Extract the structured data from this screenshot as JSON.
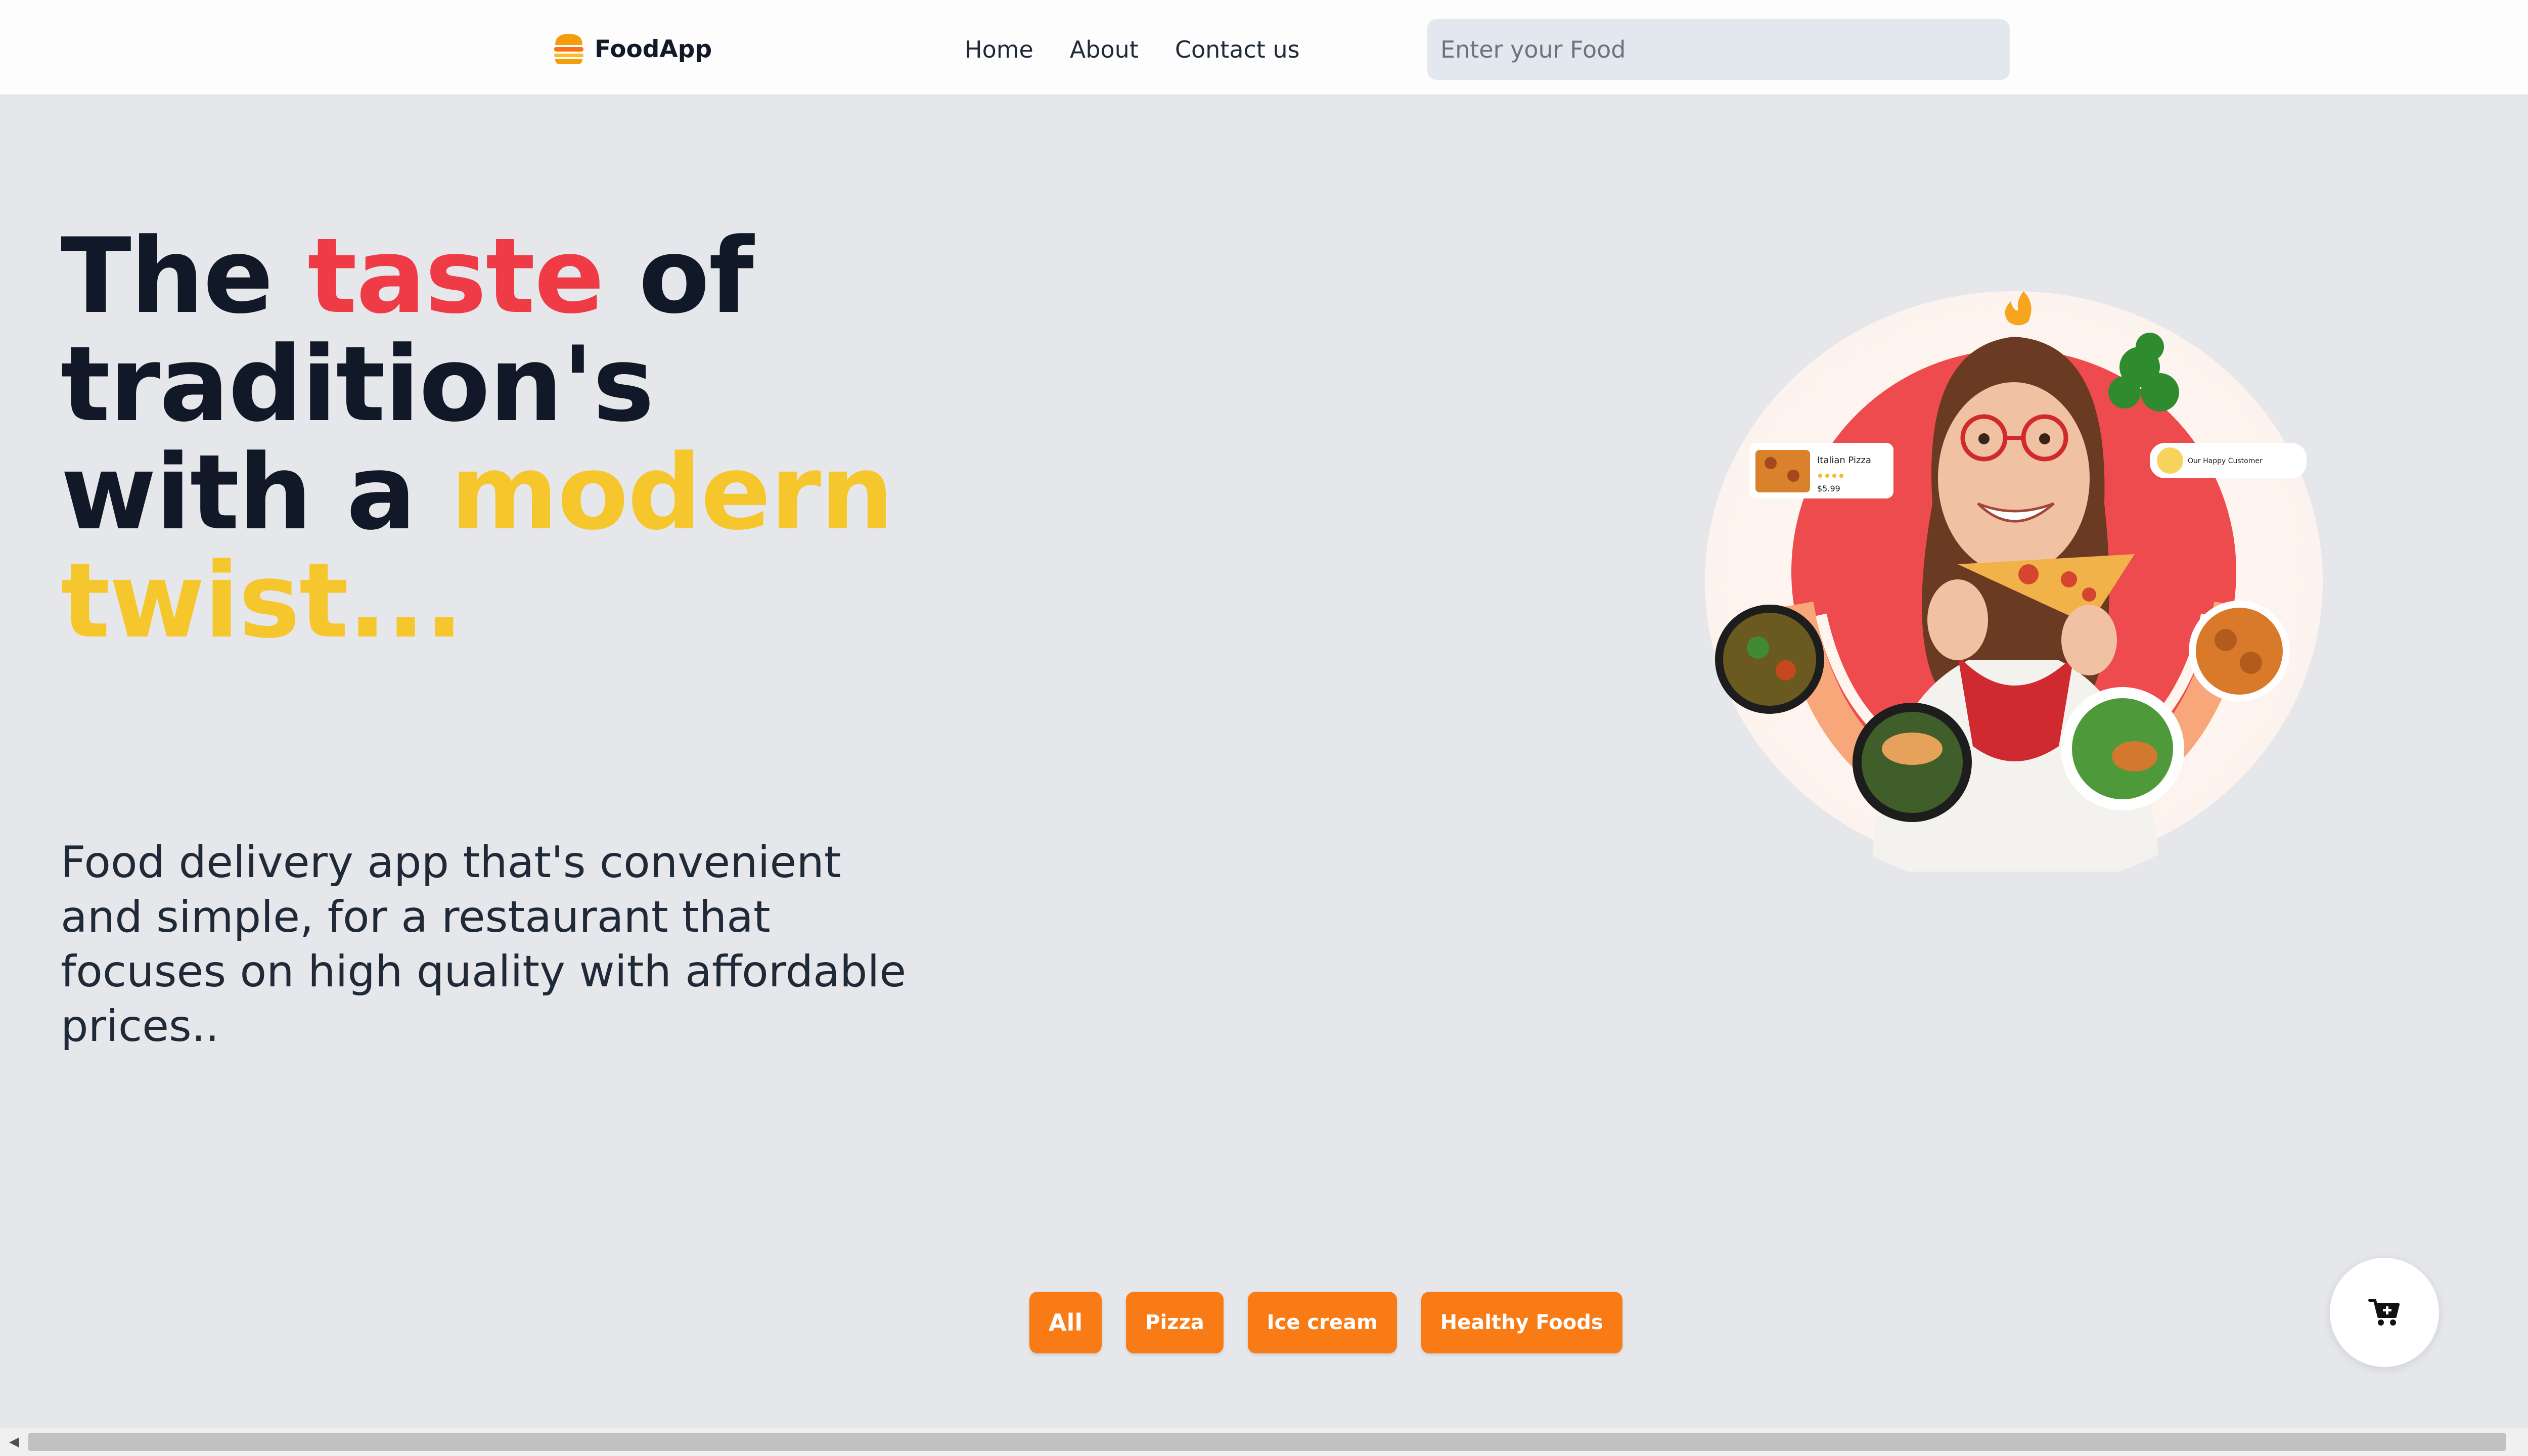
{
  "navbar": {
    "logo_text": "FoodApp",
    "links": [
      "Home",
      "About",
      "Contact us"
    ],
    "search_placeholder": "Enter your Food"
  },
  "hero": {
    "heading": {
      "part1": "The ",
      "highlight1": "taste",
      "part2": " of tradition's with a ",
      "highlight2": "modern twist..."
    },
    "description": "Food delivery app that's convenient and simple, for a restaurant that focuses on high quality with affordable prices..",
    "image_card_left": {
      "title": "Italian Pizza",
      "price": "$5.99"
    },
    "image_card_right": {
      "title": "Our Happy Customer"
    }
  },
  "categories": [
    "All",
    "Pizza",
    "Ice cream",
    "Healthy Foods"
  ],
  "colors": {
    "accent_orange": "#f97b16",
    "highlight_red": "#ef3b45",
    "highlight_yellow": "#f5c72c",
    "background": "#e6e7ea"
  },
  "icons": {
    "logo": "burger-icon",
    "cart": "cart-icon"
  }
}
